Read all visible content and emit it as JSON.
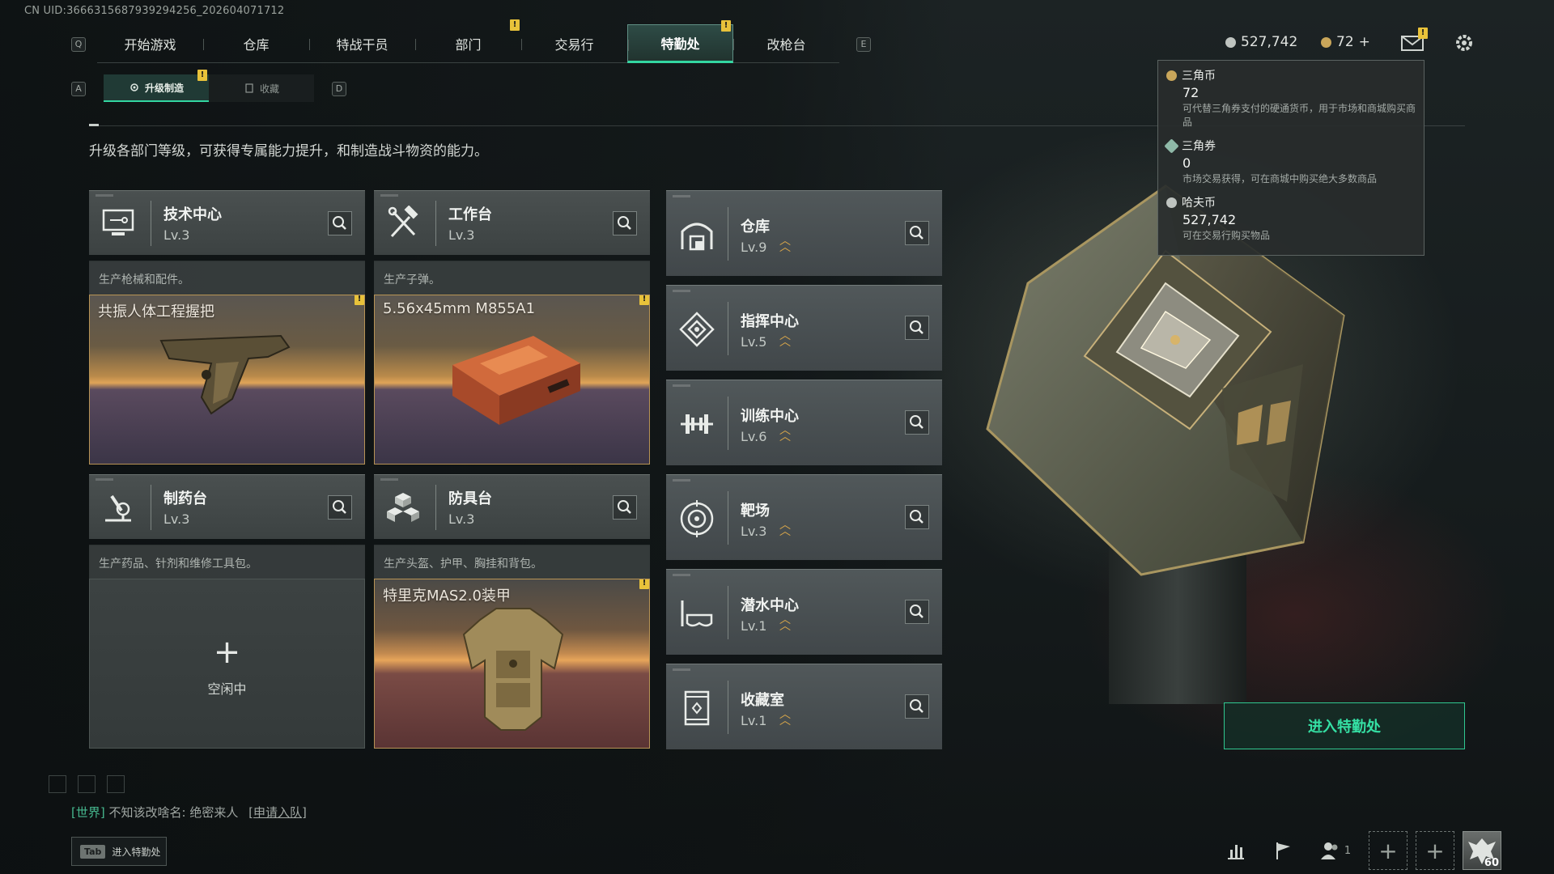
{
  "uid_text": "CN UID:3666315687939294256_202604071712",
  "nav": {
    "left_key": "Q",
    "right_key": "E",
    "items": [
      {
        "label": "开始游戏"
      },
      {
        "label": "仓库"
      },
      {
        "label": "特战干员"
      },
      {
        "label": "部门"
      },
      {
        "label": "交易行"
      },
      {
        "label": "特勤处"
      },
      {
        "label": "改枪台"
      }
    ],
    "active_index": 5
  },
  "subtabs": {
    "left_key": "A",
    "right_key": "D",
    "items": [
      {
        "label": "升级制造"
      },
      {
        "label": "收藏"
      }
    ]
  },
  "intro": "升级各部门等级，可获得专属能力提升，和制造战斗物资的能力。",
  "production": [
    {
      "name": "技术中心",
      "level": "Lv.3",
      "icon": "monitor-icon",
      "desc": "生产枪械和配件。",
      "craft": "共振人体工程握把",
      "state": "crafting"
    },
    {
      "name": "工作台",
      "level": "Lv.3",
      "icon": "hammer-wrench-icon",
      "desc": "生产子弹。",
      "craft": "5.56x45mm M855A1",
      "state": "crafting"
    },
    {
      "name": "制药台",
      "level": "Lv.3",
      "icon": "microscope-icon",
      "desc": "生产药品、针剂和维修工具包。",
      "craft": "",
      "state": "idle",
      "idle_label": "空闲中"
    },
    {
      "name": "防具台",
      "level": "Lv.3",
      "icon": "armor-blocks-icon",
      "desc": "生产头盔、护甲、胸挂和背包。",
      "craft": "特里克MAS2.0装甲",
      "state": "crafting"
    }
  ],
  "departments": [
    {
      "name": "仓库",
      "level": "Lv.9",
      "icon": "warehouse-icon"
    },
    {
      "name": "指挥中心",
      "level": "Lv.5",
      "icon": "command-icon"
    },
    {
      "name": "训练中心",
      "level": "Lv.6",
      "icon": "dumbbell-icon"
    },
    {
      "name": "靶场",
      "level": "Lv.3",
      "icon": "target-icon"
    },
    {
      "name": "潜水中心",
      "level": "Lv.1",
      "icon": "diving-mask-icon"
    },
    {
      "name": "收藏室",
      "level": "Lv.1",
      "icon": "collection-icon"
    }
  ],
  "currency": {
    "hafu_coin": "527,742",
    "triangle_coin": "72"
  },
  "tooltip": [
    {
      "title": "三角币",
      "value": "72",
      "desc": "可代替三角券支付的硬通货币，用于市场和商城购买商品"
    },
    {
      "title": "三角券",
      "value": "0",
      "desc": "市场交易获得，可在商城中购买绝大多数商品"
    },
    {
      "title": "哈夫币",
      "value": "527,742",
      "desc": "可在交易行购买物品"
    }
  ],
  "enter_button": "进入特勤处",
  "chat": {
    "channel": "[世界]",
    "sender": "不知该改啥名:",
    "message": "绝密来人",
    "link": "[申请入队]"
  },
  "tab_hint": {
    "key": "Tab",
    "label": "进入特勤处"
  },
  "friends_count": "1",
  "player_level": "60",
  "colors": {
    "accent_green": "#33d6a1",
    "alert_yellow": "#e8c23a",
    "upgrade_gold": "#d8a64a"
  }
}
